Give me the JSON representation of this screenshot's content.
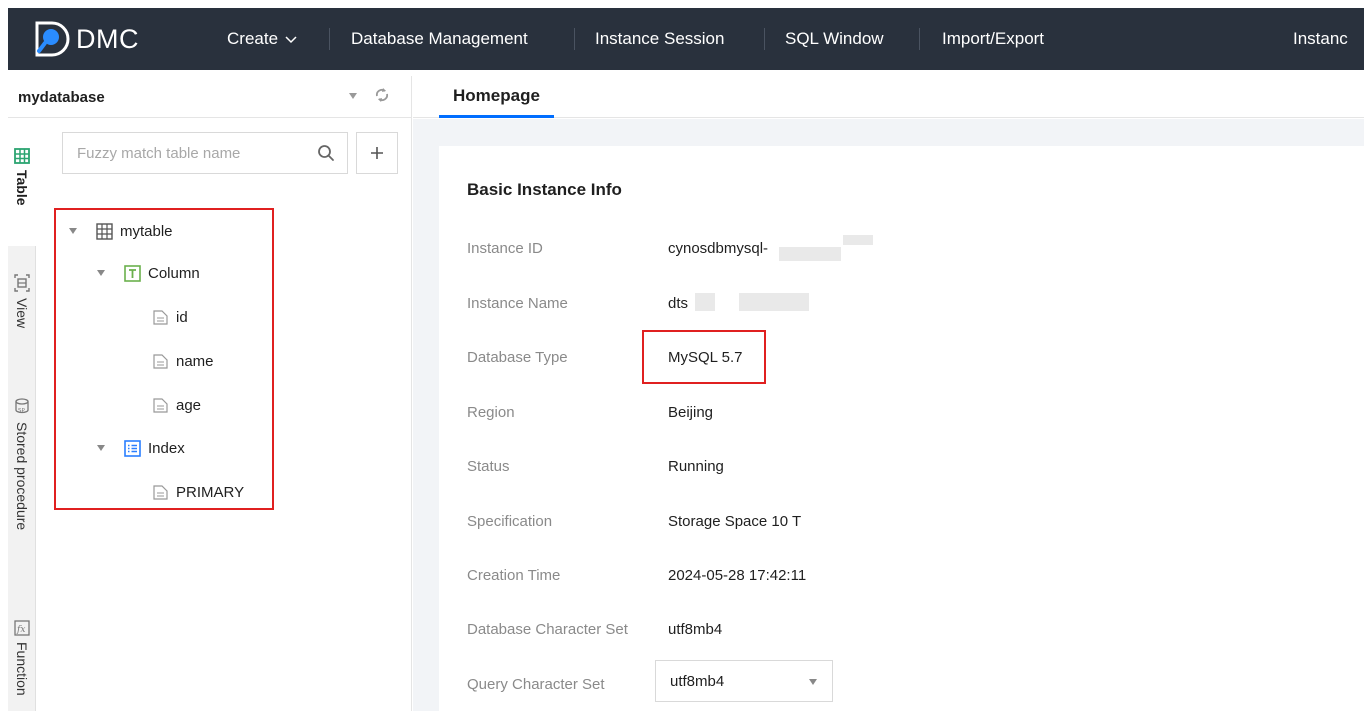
{
  "app": {
    "name": "DMC"
  },
  "nav": {
    "create": "Create",
    "database_management": "Database Management",
    "instance_session": "Instance Session",
    "sql_window": "SQL Window",
    "import_export": "Import/Export",
    "instance": "Instanc"
  },
  "database": {
    "name": "mydatabase"
  },
  "sidebar": {
    "tabs": [
      {
        "label": "Table",
        "icon": "table-icon"
      },
      {
        "label": "View",
        "icon": "view-icon"
      },
      {
        "label": "Stored procedure",
        "icon": "stored-procedure-icon"
      },
      {
        "label": "Function",
        "icon": "function-icon"
      }
    ]
  },
  "search": {
    "placeholder": "Fuzzy match table name"
  },
  "tree": {
    "table": "mytable",
    "column_group": "Column",
    "columns": [
      "id",
      "name",
      "age"
    ],
    "index_group": "Index",
    "indexes": [
      "PRIMARY"
    ]
  },
  "tabs": {
    "homepage": "Homepage"
  },
  "instance_info": {
    "title": "Basic Instance Info",
    "fields": [
      {
        "label": "Instance ID",
        "value": "cynosdbmysql-"
      },
      {
        "label": "Instance Name",
        "value": "dts"
      },
      {
        "label": "Database Type",
        "value": "MySQL 5.7"
      },
      {
        "label": "Region",
        "value": "Beijing"
      },
      {
        "label": "Status",
        "value": "Running"
      },
      {
        "label": "Specification",
        "value": "Storage Space 10 T"
      },
      {
        "label": "Creation Time",
        "value": "2024-05-28 17:42:11"
      },
      {
        "label": "Database Character Set",
        "value": "utf8mb4"
      },
      {
        "label": "Query Character Set",
        "value": "utf8mb4"
      }
    ]
  },
  "colors": {
    "topbar": "#29313d",
    "accent": "#006eff",
    "highlight": "#e02020"
  }
}
